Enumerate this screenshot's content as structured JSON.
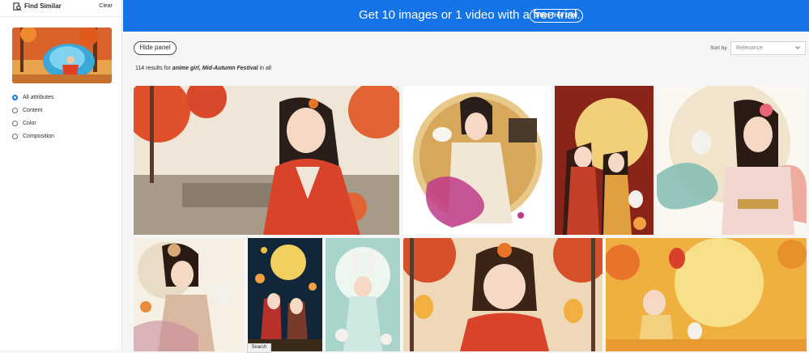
{
  "sidebar": {
    "title": "Find Similar",
    "clear_label": "Clear",
    "options": [
      {
        "label": "All attributes",
        "checked": true
      },
      {
        "label": "Content",
        "checked": false
      },
      {
        "label": "Color",
        "checked": false
      },
      {
        "label": "Composition",
        "checked": false
      }
    ]
  },
  "banner": {
    "text": "Get 10 images or 1 video with a free trial.",
    "button_label": "Start free trial",
    "color": "#1473e6"
  },
  "toolbar": {
    "hide_panel_label": "Hide panel",
    "sort_label": "Sort by",
    "sort_value": "Relevance"
  },
  "results": {
    "count_text": "114 results for",
    "query": "anime girl, Mid-Autumn Festival",
    "scope_text": "in all"
  },
  "images": [
    {
      "name": "autumn-girl-red-hanfu"
    },
    {
      "name": "girl-with-rabbit-moon-circle"
    },
    {
      "name": "two-girls-full-moon-rabbit"
    },
    {
      "name": "smiling-girl-rabbit-floral"
    },
    {
      "name": "girl-with-rabbit-lantern"
    },
    {
      "name": "children-lanterns-night"
    },
    {
      "name": "bunny-ears-girl-teal"
    },
    {
      "name": "chibi-girl-autumn-lanterns"
    },
    {
      "name": "child-full-moon-rabbit"
    }
  ],
  "tooltip": "Search"
}
